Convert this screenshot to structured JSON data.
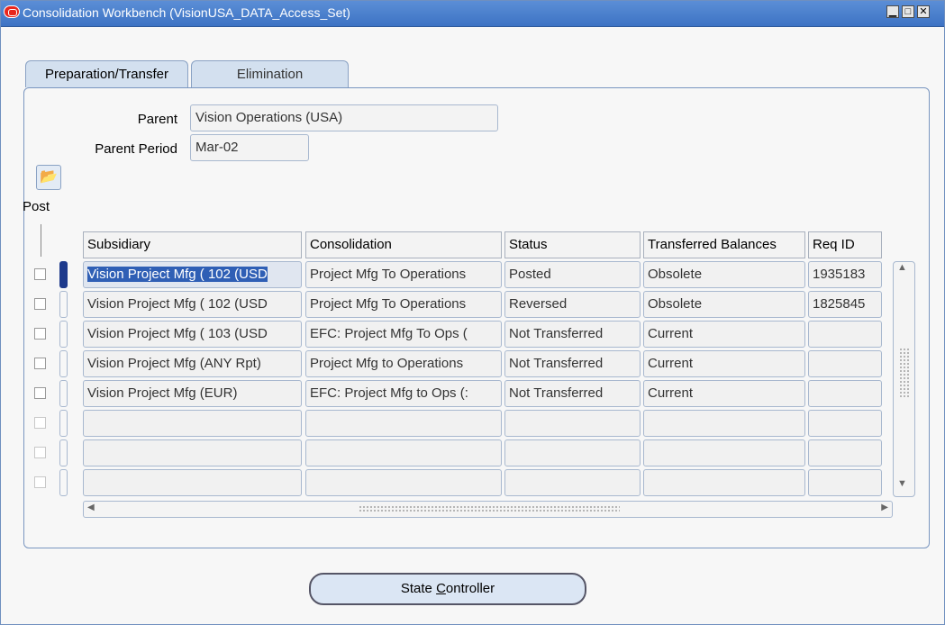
{
  "window": {
    "title": "Consolidation Workbench (VisionUSA_DATA_Access_Set)"
  },
  "tabs": [
    {
      "label": "Preparation/Transfer",
      "active": true
    },
    {
      "label": "Elimination",
      "active": false
    }
  ],
  "form": {
    "parent_label": "Parent",
    "parent_value": "Vision Operations (USA)",
    "parent_period_label": "Parent Period",
    "parent_period_value": "Mar-02",
    "post_label": "Post"
  },
  "table": {
    "columns": [
      "Subsidiary",
      "Consolidation",
      "Status",
      "Transferred Balances",
      "Req ID"
    ],
    "rows": [
      {
        "subsidiary": "Vision Project Mfg ( 102 (USD",
        "consolidation": "Project Mfg To Operations",
        "status": "Posted",
        "balances": "Obsolete",
        "req_id": "1935183"
      },
      {
        "subsidiary": "Vision Project Mfg ( 102 (USD",
        "consolidation": "Project Mfg To Operations",
        "status": "Reversed",
        "balances": "Obsolete",
        "req_id": "1825845"
      },
      {
        "subsidiary": "Vision Project Mfg ( 103 (USD",
        "consolidation": "EFC: Project Mfg To Ops (",
        "status": "Not Transferred",
        "balances": "Current",
        "req_id": ""
      },
      {
        "subsidiary": "Vision Project Mfg (ANY Rpt)",
        "consolidation": "Project Mfg to Operations",
        "status": "Not Transferred",
        "balances": "Current",
        "req_id": ""
      },
      {
        "subsidiary": "Vision Project Mfg (EUR)",
        "consolidation": "EFC: Project Mfg to Ops (:",
        "status": "Not Transferred",
        "balances": "Current",
        "req_id": ""
      },
      {
        "subsidiary": "",
        "consolidation": "",
        "status": "",
        "balances": "",
        "req_id": ""
      },
      {
        "subsidiary": "",
        "consolidation": "",
        "status": "",
        "balances": "",
        "req_id": ""
      },
      {
        "subsidiary": "",
        "consolidation": "",
        "status": "",
        "balances": "",
        "req_id": ""
      }
    ]
  },
  "buttons": {
    "state_controller_prefix": "State ",
    "state_controller_mnemonic": "C",
    "state_controller_suffix": "ontroller"
  },
  "icons": {
    "app": "oracle-icon",
    "open": "open-folder-icon"
  }
}
